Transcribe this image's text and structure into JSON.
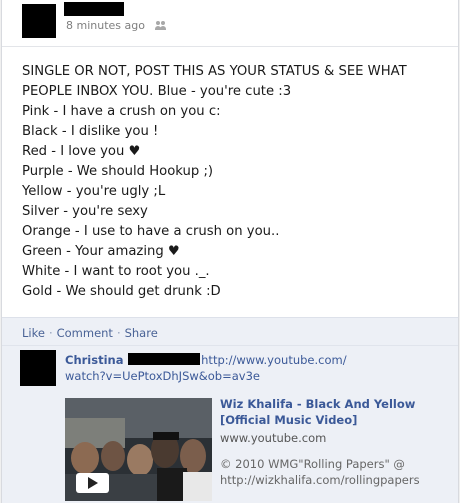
{
  "post": {
    "timestamp": "8 minutes ago",
    "privacy_icon": "friends-icon",
    "status_lines": [
      "SINGLE OR NOT, POST THIS AS YOUR STATUS & SEE WHAT PEOPLE INBOX YOU. Blue - you're cute :3",
      "Pink - I have a crush on you c:",
      "Black - I dislike you !",
      "Red - I love you ♥",
      "Purple - We should Hookup ;)",
      "Yellow - you're ugly ;L",
      "Silver - you're sexy",
      "Orange - I use to have a crush on you..",
      "Green - Your amazing ♥",
      "White - I want to root you ._.",
      "Gold - We should get drunk :D"
    ]
  },
  "actions": {
    "like": "Like",
    "comment": "Comment",
    "share": "Share",
    "separator": "·"
  },
  "comment": {
    "author": "Christina",
    "url_line1": "http://www.youtube.com/",
    "url_line2": "watch?v=UePtoxDhJSw&ob=av3e"
  },
  "video": {
    "title": "Wiz Khalifa - Black And Yellow [Official Music Video]",
    "domain": "www.youtube.com",
    "description": "© 2010 WMG\"Rolling Papers\" @ http://wizkhalifa.com/rollingpapers",
    "play_icon": "play-icon"
  },
  "colors": {
    "link": "#3b5998",
    "action_bg": "#edf0f6"
  }
}
